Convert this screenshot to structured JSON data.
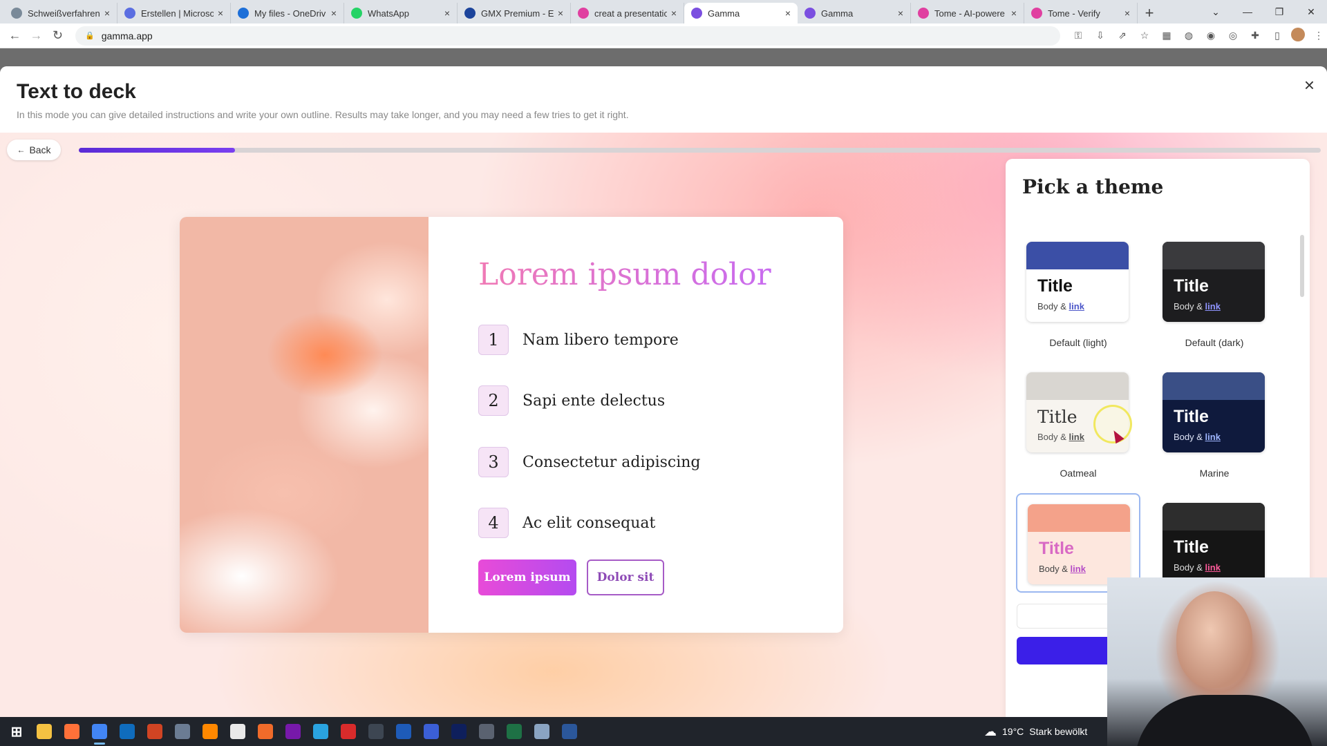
{
  "browser": {
    "tabs": [
      {
        "label": "Schweißverfahren",
        "color": "#7a8a99"
      },
      {
        "label": "Erstellen | Microso",
        "color": "#5b6ee1"
      },
      {
        "label": "My files - OneDriv",
        "color": "#1d6fd8"
      },
      {
        "label": "WhatsApp",
        "color": "#25d366"
      },
      {
        "label": "GMX Premium - E",
        "color": "#1c449b"
      },
      {
        "label": "creat a presentatio",
        "color": "#e040a0"
      },
      {
        "label": "Gamma",
        "color": "#7b4fe0"
      },
      {
        "label": "Gamma",
        "color": "#7b4fe0"
      },
      {
        "label": "Tome - AI-powere",
        "color": "#e040a0"
      },
      {
        "label": "Tome - Verify",
        "color": "#e040a0"
      }
    ],
    "active_tab_index": 6,
    "url": "gamma.app"
  },
  "modal": {
    "title": "Text to deck",
    "subtitle": "In this mode you can give detailed instructions and write your own outline. Results may take longer, and you may need a few tries to get it right.",
    "back_label": "Back",
    "progress_fraction": 0.126
  },
  "preview": {
    "title": "Lorem ipsum dolor",
    "items": [
      {
        "num": "1",
        "text": "Nam libero tempore"
      },
      {
        "num": "2",
        "text": "Sapi ente delectus"
      },
      {
        "num": "3",
        "text": "Consectetur adipiscing"
      },
      {
        "num": "4",
        "text": "Ac elit consequat"
      }
    ],
    "primary_button": "Lorem ipsum",
    "secondary_button": "Dolor sit"
  },
  "theme_panel": {
    "title": "Pick a theme",
    "themes": [
      {
        "name": "Default (light)",
        "card_title": "Title",
        "body": "Body &",
        "link": "link",
        "bg": "#ffffff",
        "band": "#3b4fa6",
        "title_color": "#111111",
        "body_color": "#444444",
        "link_color": "#4b56c9"
      },
      {
        "name": "Default (dark)",
        "card_title": "Title",
        "body": "Body &",
        "link": "link",
        "bg": "#1d1d1f",
        "band": "#3a3a3d",
        "title_color": "#ffffff",
        "body_color": "#dddddd",
        "link_color": "#8f94ff"
      },
      {
        "name": "Oatmeal",
        "card_title": "Title",
        "body": "Body &",
        "link": "link",
        "bg": "#f7f4ef",
        "band": "#d9d6d1",
        "title_color": "#333333",
        "body_color": "#555555",
        "link_color": "#555555"
      },
      {
        "name": "Marine",
        "card_title": "Title",
        "body": "Body &",
        "link": "link",
        "bg": "#0f1a3d",
        "band": "#3a4f86",
        "title_color": "#ffffff",
        "body_color": "#dde3f5",
        "link_color": "#9fb6ff"
      },
      {
        "name": "",
        "card_title": "Title",
        "body": "Body &",
        "link": "link",
        "bg": "#fde7de",
        "band": "#f4a28a",
        "title_color": "#d869c4",
        "body_color": "#444444",
        "link_color": "#b44bc6"
      },
      {
        "name": "",
        "card_title": "Title",
        "body": "Body &",
        "link": "link",
        "bg": "#151515",
        "band": "#2d2d2d",
        "title_color": "#ffffff",
        "body_color": "#dddddd",
        "link_color": "#ff5a9a"
      }
    ],
    "selected_index": 4
  },
  "taskbar": {
    "icons": [
      "windows-start-icon",
      "file-explorer-icon",
      "firefox-icon",
      "chrome-icon",
      "outlook-icon",
      "powerpoint-icon",
      "app-icon",
      "vlc-icon",
      "app-icon",
      "app-icon",
      "onenote-icon",
      "telegram-icon",
      "acrobat-icon",
      "app-icon",
      "app-icon",
      "app-icon",
      "app-icon",
      "app-icon",
      "excel-icon",
      "app-icon",
      "word-icon"
    ],
    "weather_temp": "19°C",
    "weather_text": "Stark bewölkt"
  }
}
